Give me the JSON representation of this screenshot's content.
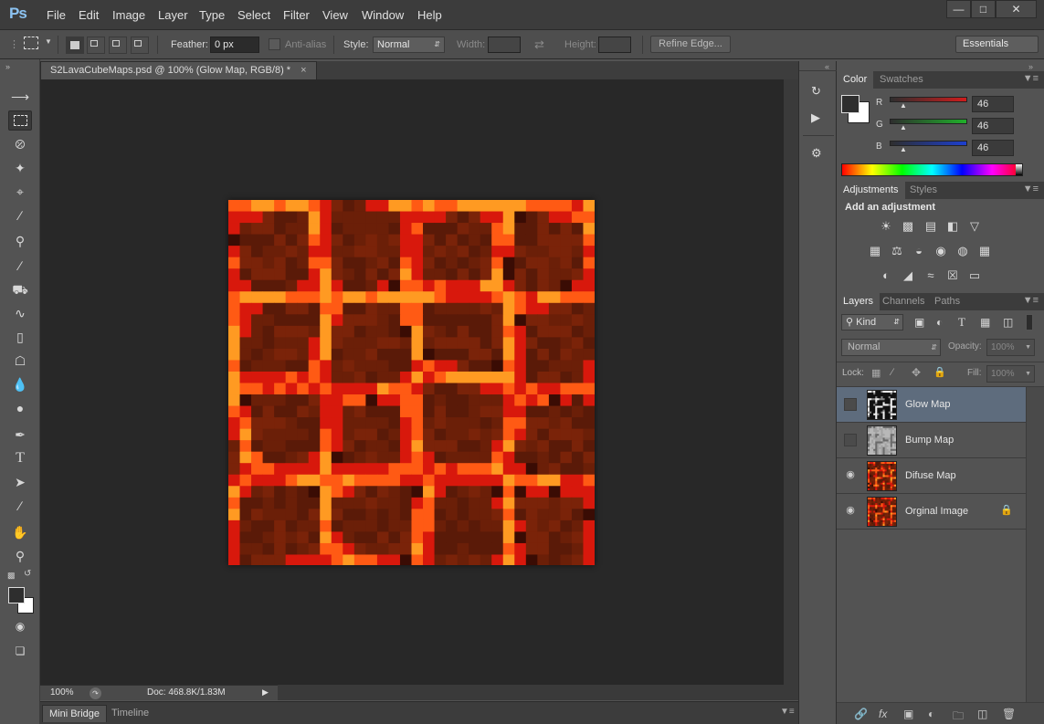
{
  "app": {
    "logo": "Ps",
    "menu": [
      "File",
      "Edit",
      "Image",
      "Layer",
      "Type",
      "Select",
      "Filter",
      "View",
      "Window",
      "Help"
    ],
    "window_controls": [
      "minimize-icon",
      "maximize-icon",
      "close-icon"
    ]
  },
  "options": {
    "feather_label": "Feather:",
    "feather_value": "0 px",
    "antialias_label": "Anti-alias",
    "style_label": "Style:",
    "style_value": "Normal",
    "width_label": "Width:",
    "height_label": "Height:",
    "refine_edge": "Refine Edge...",
    "workspace": "Essentials"
  },
  "document": {
    "tab_title": "S2LavaCubeMaps.psd @ 100% (Glow Map, RGB/8) *",
    "zoom": "100%",
    "doc_size": "Doc: 468.8K/1.83M",
    "bottom_tabs": [
      "Mini Bridge",
      "Timeline"
    ]
  },
  "tools": [
    "move-tool",
    "marquee-tool",
    "lasso-tool",
    "magic-wand-tool",
    "crop-tool",
    "eyedropper-tool",
    "healing-brush-tool",
    "brush-tool",
    "clone-stamp-tool",
    "history-brush-tool",
    "eraser-tool",
    "paint-bucket-tool",
    "blur-tool",
    "dodge-tool",
    "pen-tool",
    "type-tool",
    "path-selection-tool",
    "line-tool",
    "hand-tool",
    "zoom-tool"
  ],
  "color_panel": {
    "tabs": [
      "Color",
      "Swatches"
    ],
    "r_label": "R",
    "g_label": "G",
    "b_label": "B",
    "r": "46",
    "g": "46",
    "b": "46",
    "accent_r": "#d01c1c",
    "accent_g": "#1fb02a",
    "accent_b": "#1c3fd0"
  },
  "adjustments_panel": {
    "tabs": [
      "Adjustments",
      "Styles"
    ],
    "heading": "Add an adjustment"
  },
  "layers_panel": {
    "tabs": [
      "Layers",
      "Channels",
      "Paths"
    ],
    "filter_kind": "Kind",
    "blend_mode": "Normal",
    "opacity_label": "Opacity:",
    "opacity_value": "100%",
    "lock_label": "Lock:",
    "fill_label": "Fill:",
    "fill_value": "100%",
    "layers": [
      {
        "name": "Glow Map",
        "visible": false,
        "selected": true
      },
      {
        "name": "Bump Map",
        "visible": false,
        "selected": false
      },
      {
        "name": "Difuse Map",
        "visible": true,
        "selected": false
      },
      {
        "name": "Orginal Image",
        "visible": true,
        "selected": false,
        "locked": true
      }
    ]
  },
  "colors": {
    "lava_dark": "#5a1a08",
    "lava_mid": "#7a2309",
    "lava_red": "#d8180c",
    "lava_orange": "#ff5a14",
    "lava_yellow": "#ff9a22"
  }
}
